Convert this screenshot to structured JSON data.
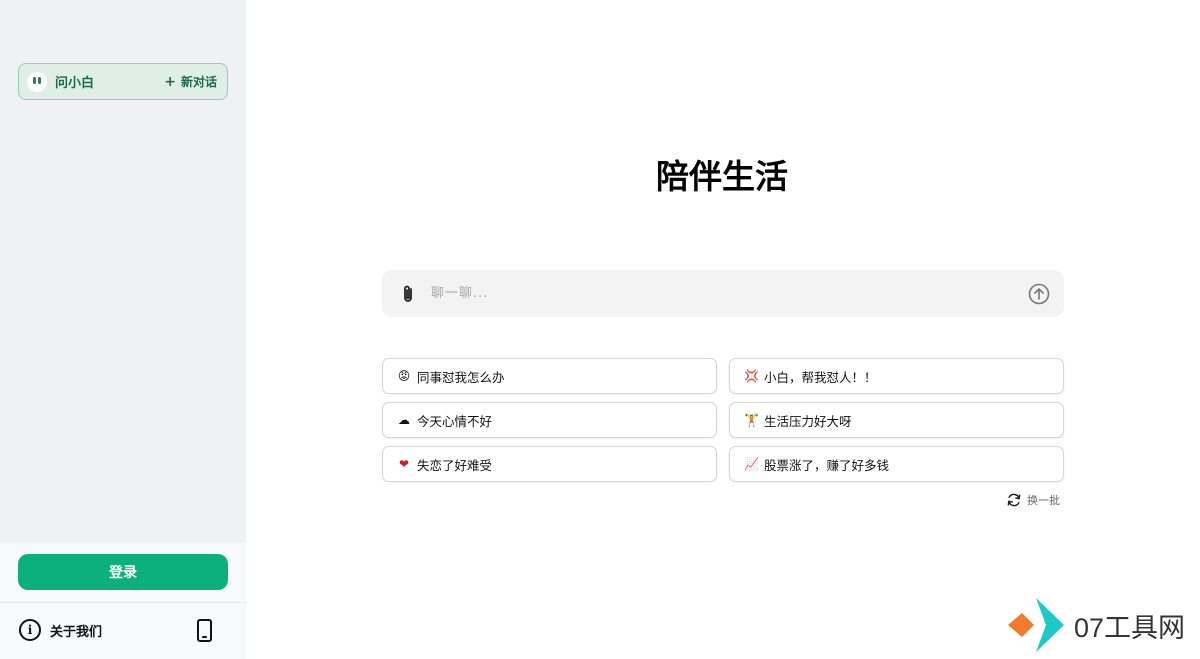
{
  "sidebar": {
    "chat": {
      "name": "问小白",
      "new_chat_label": "新对话"
    },
    "login_label": "登录",
    "about_label": "关于我们"
  },
  "main": {
    "title": "陪伴生活",
    "input": {
      "placeholder": "聊一聊..."
    },
    "prompts": [
      {
        "emoji": "😡",
        "text": "同事怼我怎么办"
      },
      {
        "emoji": "💢",
        "text": "小白，帮我怼人！！"
      },
      {
        "emoji": "☁",
        "text": "今天心情不好"
      },
      {
        "emoji": "🏋",
        "text": "生活压力好大呀"
      },
      {
        "emoji": "❤",
        "text": "失恋了好难受"
      },
      {
        "emoji": "📈",
        "text": "股票涨了，赚了好多钱"
      }
    ],
    "refresh_label": "换一批"
  },
  "watermark": {
    "text": "07工具网"
  },
  "colors": {
    "accent": "#0bb07b",
    "pill_bg": "#dfeee7",
    "pill_border": "#8fd0b2",
    "sidebar_bg": "#f0f1f3"
  },
  "icons": [
    "bot-avatar-icon",
    "plus-icon",
    "paperclip-icon",
    "send-arrow-icon",
    "refresh-icon",
    "info-icon",
    "phone-icon",
    "watermark-logo-icon"
  ]
}
